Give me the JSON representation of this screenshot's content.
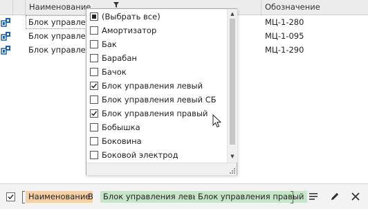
{
  "grid": {
    "columns": {
      "name": "Наименование",
      "code": "Обозначение"
    },
    "rows": [
      {
        "name": "Блок управления левый",
        "code": "МЦ-1-280"
      },
      {
        "name": "Блок управления",
        "code": "МЦ-1-095"
      },
      {
        "name": "Блок управления",
        "code": "МЦ-1-290"
      }
    ],
    "row_icon": "assembly-icon"
  },
  "filter_popup": {
    "items": [
      {
        "label": "(Выбрать все)",
        "state": "indeterminate"
      },
      {
        "label": "Амортизатор",
        "state": "unchecked"
      },
      {
        "label": "Бак",
        "state": "unchecked"
      },
      {
        "label": "Барабан",
        "state": "unchecked"
      },
      {
        "label": "Бачок",
        "state": "unchecked"
      },
      {
        "label": "Блок управления левый",
        "state": "checked"
      },
      {
        "label": "Блок управления левый СБ",
        "state": "unchecked"
      },
      {
        "label": "Блок управления правый",
        "state": "checked"
      },
      {
        "label": "Бобышка",
        "state": "unchecked"
      },
      {
        "label": "Боковина",
        "state": "unchecked"
      },
      {
        "label": "Боковой электрод",
        "state": "unchecked"
      }
    ]
  },
  "filter_bar": {
    "enabled": true,
    "field": "Наименование",
    "operator": "В",
    "values": [
      "Блок управления левый",
      "Блок управления правый"
    ]
  },
  "colors": {
    "field_tag": "#f5cfa6",
    "value_tag": "#c7e6c9",
    "icon_blue": "#1f5fb0"
  }
}
